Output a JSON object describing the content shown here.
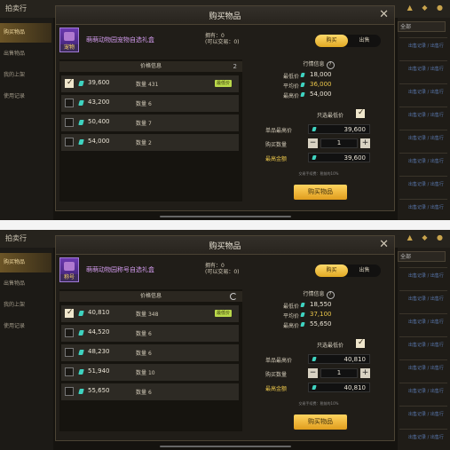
{
  "background": {
    "app_title": "拍卖行",
    "sidebar": [
      "购买物品",
      "出售物品",
      "我的上架",
      "使用记录"
    ],
    "right_dropdown": "全部",
    "right_link": "出售记录 / 出售行"
  },
  "panels": [
    {
      "title": "购买物品",
      "item_tag": "宠物",
      "item_name": "萌萌动物园宠物自选礼盒",
      "own_line1": "拥有：0",
      "own_line2": "(可以交易：0)",
      "tabs": [
        "购买",
        "出售"
      ],
      "list_header": "价格信息",
      "list_count": "2",
      "qty_label": "数量",
      "lowest_badge": "最低价",
      "rows": [
        {
          "price": "39,600",
          "qty": "431",
          "checked": true
        },
        {
          "price": "43,200",
          "qty": "6",
          "checked": false
        },
        {
          "price": "50,400",
          "qty": "7",
          "checked": false
        },
        {
          "price": "54,000",
          "qty": "2",
          "checked": false
        }
      ],
      "market_title": "行情信息",
      "market": [
        {
          "label": "最低价",
          "value": "18,000"
        },
        {
          "label": "平均价",
          "value": "36,000"
        },
        {
          "label": "最高价",
          "value": "54,000"
        }
      ],
      "only_lowest": "只选最低价",
      "unit_price_label": "单品最高价",
      "unit_price": "39,600",
      "buy_qty_label": "购买数量",
      "buy_qty": "1",
      "total_label": "最高金额",
      "total": "39,600",
      "tax_note": "交易手续费：税前的10%",
      "buy_button": "购买物品"
    },
    {
      "title": "购买物品",
      "item_tag": "称号",
      "item_name": "萌萌动物园称号自选礼盒",
      "own_line1": "拥有：0",
      "own_line2": "(可以交易：0)",
      "tabs": [
        "购买",
        "出售"
      ],
      "list_header": "价格信息",
      "list_count": "",
      "qty_label": "数量",
      "lowest_badge": "最低价",
      "rows": [
        {
          "price": "40,810",
          "qty": "348",
          "checked": true
        },
        {
          "price": "44,520",
          "qty": "6",
          "checked": false
        },
        {
          "price": "48,230",
          "qty": "6",
          "checked": false
        },
        {
          "price": "51,940",
          "qty": "10",
          "checked": false
        },
        {
          "price": "55,650",
          "qty": "6",
          "checked": false
        }
      ],
      "market_title": "行情信息",
      "market": [
        {
          "label": "最低价",
          "value": "18,550"
        },
        {
          "label": "平均价",
          "value": "37,100"
        },
        {
          "label": "最高价",
          "value": "55,650"
        }
      ],
      "only_lowest": "只选最低价",
      "unit_price_label": "单品最高价",
      "unit_price": "40,810",
      "buy_qty_label": "购买数量",
      "buy_qty": "1",
      "total_label": "最高金额",
      "total": "40,810",
      "tax_note": "交易手续费：税前的10%",
      "buy_button": "购买物品"
    }
  ],
  "colors": {
    "accent": "#e0a924",
    "gem": "#3fd3c0",
    "lowest_badge": "#b9d84a"
  }
}
